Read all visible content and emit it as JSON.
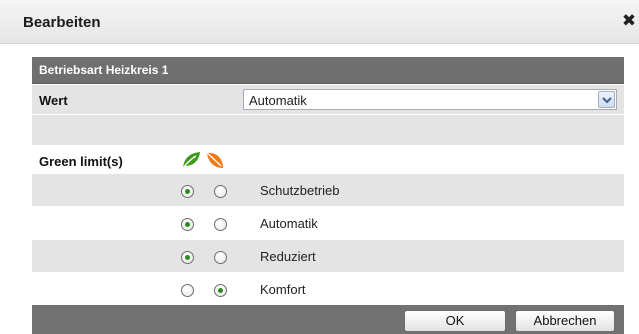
{
  "dialog": {
    "title": "Bearbeiten",
    "close_icon": "close-icon"
  },
  "section": {
    "header": "Betriebsart Heizkreis 1"
  },
  "wert": {
    "label": "Wert",
    "selected": "Automatik",
    "dropdown_icon": "chevron-down-icon"
  },
  "green_limits": {
    "label": "Green limit(s)",
    "icons": [
      "green-leaf-icon",
      "orange-leaf-icon"
    ],
    "colors": {
      "green_leaf": "#3e9a1c",
      "orange_leaf": "#f07a14",
      "radio_dot": "#2f8a1e"
    },
    "options": [
      {
        "label": "Schutzbetrieb",
        "selected_column": 0
      },
      {
        "label": "Automatik",
        "selected_column": 0
      },
      {
        "label": "Reduziert",
        "selected_column": 0
      },
      {
        "label": "Komfort",
        "selected_column": 1
      }
    ]
  },
  "buttons": {
    "ok": "OK",
    "cancel": "Abbrechen"
  }
}
